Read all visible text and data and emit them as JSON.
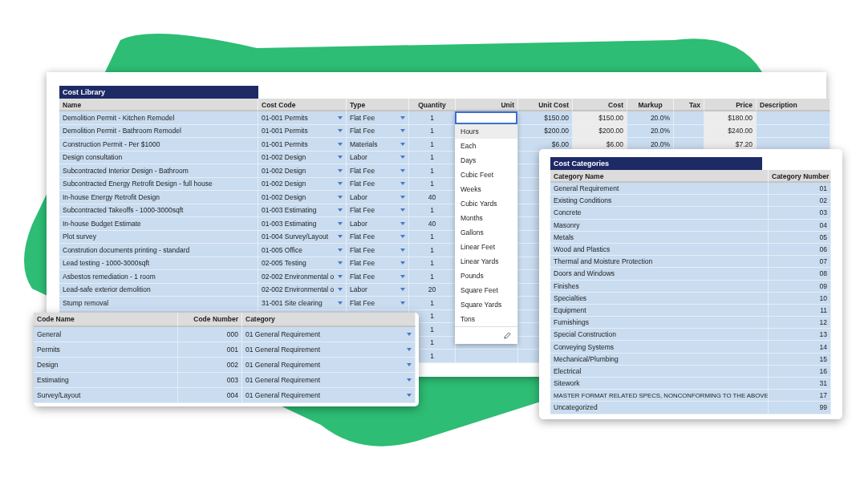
{
  "cost_library": {
    "title": "Cost Library",
    "columns": [
      "Name",
      "Cost Code",
      "Type",
      "Quantity",
      "Unit",
      "Unit Cost",
      "Cost",
      "Markup",
      "Tax",
      "Price",
      "Description"
    ],
    "rows": [
      {
        "name": "Demolition Permit - Kitchen Remodel",
        "cost_code": "01-001 Permits",
        "type": "Flat Fee",
        "quantity": "1",
        "unit_cost": "$150.00",
        "cost": "$150.00",
        "markup": "20.0%",
        "price": "$180.00"
      },
      {
        "name": "Demolition Permit - Bathroom Remodel",
        "cost_code": "01-001 Permits",
        "type": "Flat Fee",
        "quantity": "1",
        "unit_cost": "$200.00",
        "cost": "$200.00",
        "markup": "20.0%",
        "price": "$240.00"
      },
      {
        "name": "Construction Permit - Per $1000",
        "cost_code": "01-001 Permits",
        "type": "Materials",
        "quantity": "1",
        "unit_cost": "$6.00",
        "cost": "$6.00",
        "markup": "20.0%",
        "price": "$7.20"
      },
      {
        "name": "Design consultation",
        "cost_code": "01-002 Design",
        "type": "Labor",
        "quantity": "1"
      },
      {
        "name": "Subcontracted Interior Design - Bathroom",
        "cost_code": "01-002 Design",
        "type": "Flat Fee",
        "quantity": "1"
      },
      {
        "name": "Subcontracted Energy Retrofit Design - full house",
        "cost_code": "01-002 Design",
        "type": "Flat Fee",
        "quantity": "1"
      },
      {
        "name": "In-house Energy Retrofit Design",
        "cost_code": "01-002 Design",
        "type": "Labor",
        "quantity": "40"
      },
      {
        "name": "Subcontracted Takeoffs - 1000-3000sqft",
        "cost_code": "01-003 Estimating",
        "type": "Flat Fee",
        "quantity": "1"
      },
      {
        "name": "In-house Budget Estimate",
        "cost_code": "01-003 Estimating",
        "type": "Labor",
        "quantity": "40"
      },
      {
        "name": "Plot survey",
        "cost_code": "01-004 Survey/Layout",
        "type": "Flat Fee",
        "quantity": "1"
      },
      {
        "name": "Constrution documents printing - standard",
        "cost_code": "01-005 Office",
        "type": "Flat Fee",
        "quantity": "1"
      },
      {
        "name": "Lead testing - 1000-3000sqft",
        "cost_code": "02-005 Testing",
        "type": "Flat Fee",
        "quantity": "1"
      },
      {
        "name": "Asbestos remediation - 1 room",
        "cost_code": "02-002 Environmental o",
        "type": "Flat Fee",
        "quantity": "1"
      },
      {
        "name": "Lead-safe exterior demolition",
        "cost_code": "02-002 Environmental o",
        "type": "Labor",
        "quantity": "20"
      },
      {
        "name": "Stump removal",
        "cost_code": "31-001 Site clearing",
        "type": "Flat Fee",
        "quantity": "1"
      },
      {
        "quantity": "1"
      },
      {
        "quantity": "1"
      },
      {
        "quantity": "1"
      },
      {
        "quantity": "1"
      }
    ],
    "unit_menu": [
      {
        "label": "Hours",
        "selected": true
      },
      {
        "label": "Each",
        "selected": false
      },
      {
        "label": "Days",
        "selected": false
      },
      {
        "label": "Cubic Feet",
        "selected": false
      },
      {
        "label": "Weeks",
        "selected": false
      },
      {
        "label": "Cubic Yards",
        "selected": false
      },
      {
        "label": "Months",
        "selected": false
      },
      {
        "label": "Gallons",
        "selected": false
      },
      {
        "label": "Linear Feet",
        "selected": false
      },
      {
        "label": "Linear Yards",
        "selected": false
      },
      {
        "label": "Pounds",
        "selected": false
      },
      {
        "label": "Square Feet",
        "selected": false
      },
      {
        "label": "Square Yards",
        "selected": false
      },
      {
        "label": "Tons",
        "selected": false
      }
    ]
  },
  "cost_codes": {
    "columns": [
      "Code Name",
      "Code Number",
      "Category"
    ],
    "rows": [
      {
        "name": "General",
        "number": "000",
        "category": "01 General Requirement"
      },
      {
        "name": "Permits",
        "number": "001",
        "category": "01 General Requirement"
      },
      {
        "name": "Design",
        "number": "002",
        "category": "01 General Requirement"
      },
      {
        "name": "Estimating",
        "number": "003",
        "category": "01 General Requirement"
      },
      {
        "name": "Survey/Layout",
        "number": "004",
        "category": "01 General Requirement"
      }
    ]
  },
  "cost_categories": {
    "title": "Cost Categories",
    "columns": [
      "Category Name",
      "Category Number"
    ],
    "rows": [
      {
        "name": "General Requirement",
        "number": "01"
      },
      {
        "name": "Existing Conditions",
        "number": "02"
      },
      {
        "name": "Concrete",
        "number": "03"
      },
      {
        "name": "Masonry",
        "number": "04"
      },
      {
        "name": "Metals",
        "number": "05"
      },
      {
        "name": "Wood and Plastics",
        "number": "06"
      },
      {
        "name": "Thermal and Moisture Protection",
        "number": "07"
      },
      {
        "name": "Doors and Windows",
        "number": "08"
      },
      {
        "name": "Finishes",
        "number": "09"
      },
      {
        "name": "Specialties",
        "number": "10"
      },
      {
        "name": "Equipment",
        "number": "11"
      },
      {
        "name": "Furnishings",
        "number": "12"
      },
      {
        "name": "Special Construction",
        "number": "13"
      },
      {
        "name": "Conveying Systems",
        "number": "14"
      },
      {
        "name": "Mechanical/Plumbing",
        "number": "15"
      },
      {
        "name": "Electrical",
        "number": "16"
      },
      {
        "name": "Sitework",
        "number": "31"
      },
      {
        "name": "MASTER FORMAT RELATED SPECS, NONCONFORMING TO THE ABOVE",
        "number": "17"
      },
      {
        "name": "Uncategorized",
        "number": "99"
      }
    ]
  }
}
